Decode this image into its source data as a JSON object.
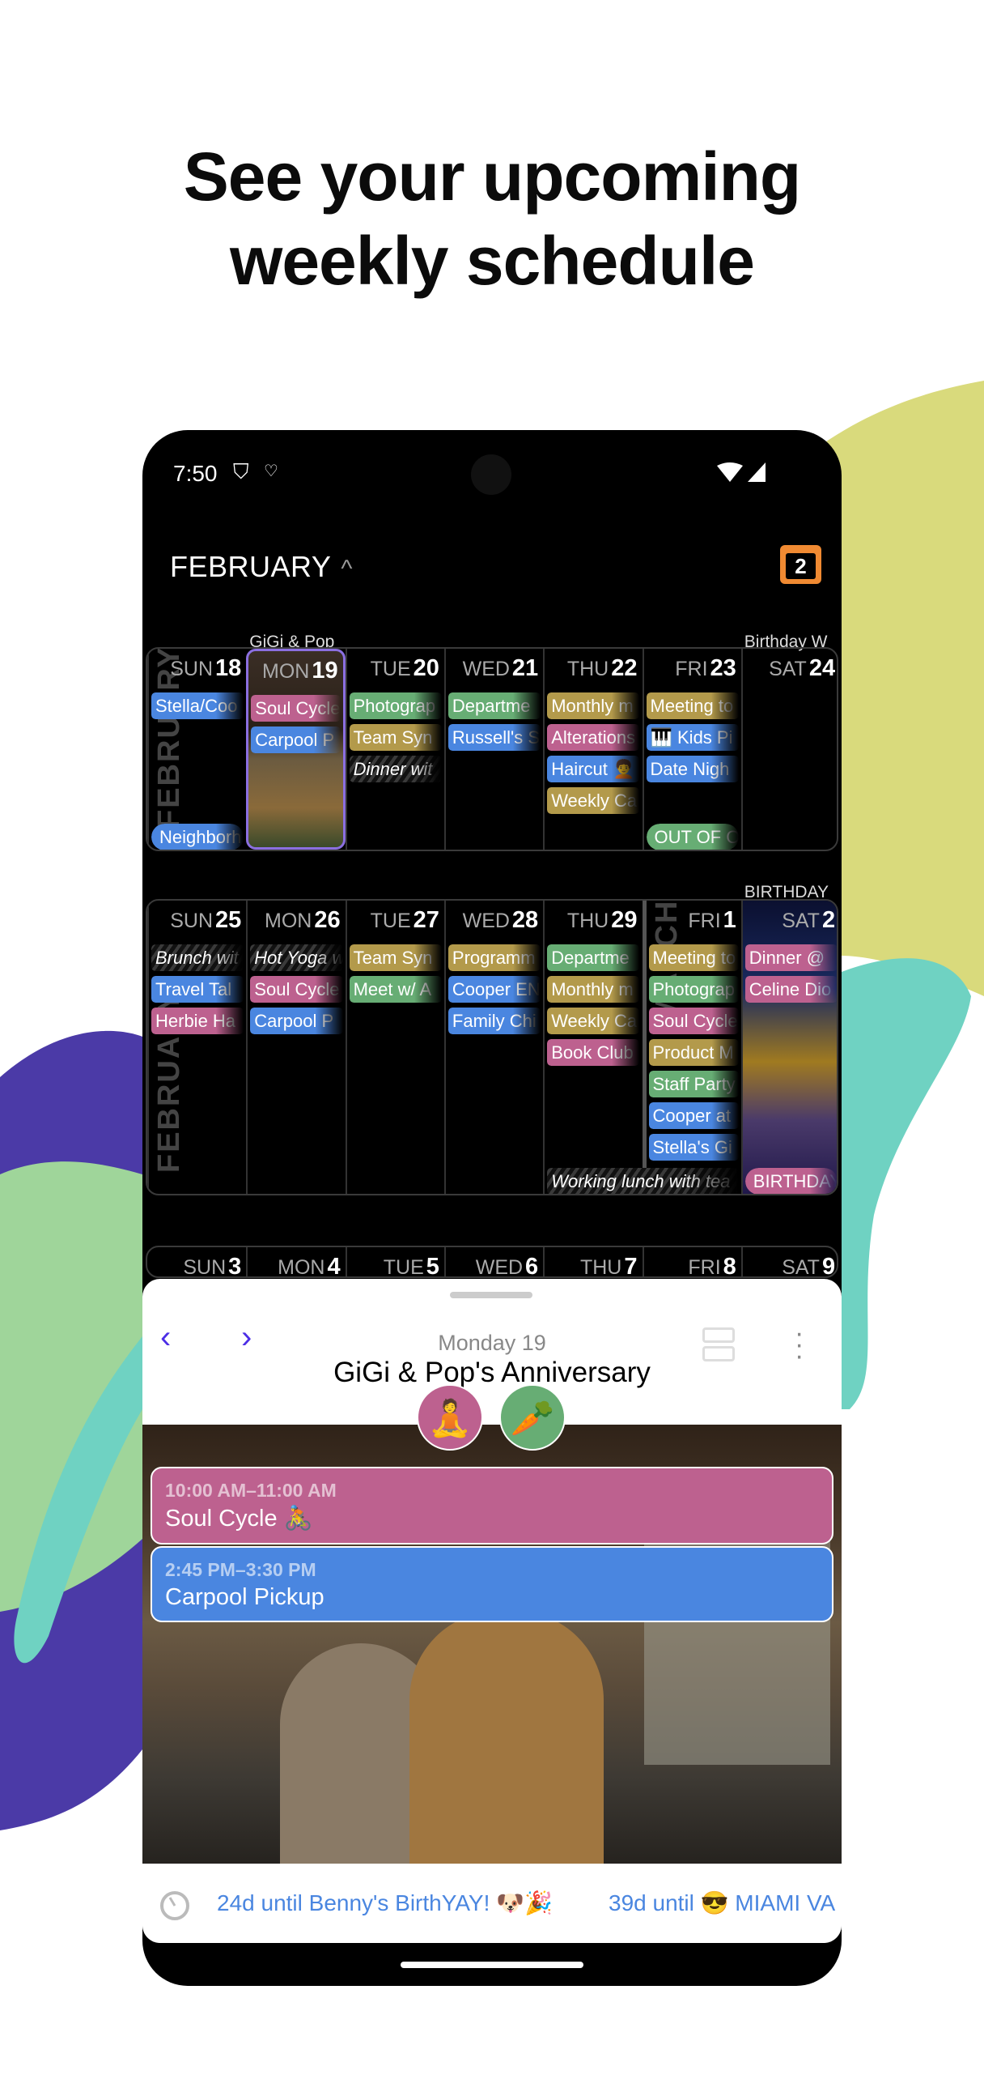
{
  "headline": {
    "line1": "See your upcoming",
    "line2": "weekly schedule"
  },
  "colors": {
    "blue": "#4a86e0",
    "pink": "#bd618f",
    "green": "#67ad74",
    "gold": "#b39a4b",
    "selected_outline": "#8b6fe0",
    "accent": "#4c2ee6",
    "today_badge": "#f08a32"
  },
  "status_bar": {
    "time": "7:50",
    "icons": [
      "shield-icon",
      "accessibility-icon",
      "wifi-icon",
      "signal-icon"
    ]
  },
  "header": {
    "month": "FEBRUARY",
    "chevron": "^",
    "today_badge": "2"
  },
  "weeks": [
    {
      "labels_above": [
        {
          "day": 1,
          "text": "GiGi & Pop"
        },
        {
          "day": 6,
          "text": "Birthday W"
        }
      ],
      "watermark": "FEBRUARY",
      "days": [
        {
          "name": "SUN",
          "date": "18",
          "events": [
            {
              "text": "Stella/Coo",
              "color": "blue"
            }
          ],
          "bottom": {
            "text": "Neighborh",
            "color": "blue"
          }
        },
        {
          "name": "MON",
          "date": "19",
          "selected": true,
          "events": [
            {
              "text": "Soul Cycle",
              "color": "pink"
            },
            {
              "text": "Carpool P",
              "color": "blue"
            }
          ]
        },
        {
          "name": "TUE",
          "date": "20",
          "events": [
            {
              "text": "Photograp",
              "color": "green"
            },
            {
              "text": "Team Syn",
              "color": "gold"
            },
            {
              "text": "Dinner wit",
              "style": "hatch"
            }
          ]
        },
        {
          "name": "WED",
          "date": "21",
          "events": [
            {
              "text": "Departme",
              "color": "green"
            },
            {
              "text": "Russell's S",
              "color": "blue"
            }
          ]
        },
        {
          "name": "THU",
          "date": "22",
          "events": [
            {
              "text": "Monthly m",
              "color": "gold"
            },
            {
              "text": "Alterations",
              "color": "pink"
            },
            {
              "text": "Haircut 🧑‍🦱",
              "color": "blue"
            },
            {
              "text": "Weekly Ca",
              "color": "gold"
            }
          ]
        },
        {
          "name": "FRI",
          "date": "23",
          "events": [
            {
              "text": "Meeting to",
              "color": "gold"
            },
            {
              "text": "🎹 Kids Pi",
              "color": "blue"
            },
            {
              "text": "Date Nigh",
              "color": "blue"
            }
          ],
          "bottom": {
            "text": "OUT OF O",
            "color": "green"
          }
        },
        {
          "name": "SAT",
          "date": "24",
          "events": []
        }
      ]
    },
    {
      "labels_above": [
        {
          "day": 6,
          "text": "BIRTHDAY"
        }
      ],
      "watermark": "FEBRUARY",
      "watermark2": "MARCH",
      "days": [
        {
          "name": "SUN",
          "date": "25",
          "events": [
            {
              "text": "Brunch wit",
              "style": "hatch"
            },
            {
              "text": "Travel Tal",
              "color": "blue"
            },
            {
              "text": "Herbie Ha",
              "color": "pink"
            }
          ]
        },
        {
          "name": "MON",
          "date": "26",
          "events": [
            {
              "text": "Hot Yoga w",
              "style": "hatch"
            },
            {
              "text": "Soul Cycle",
              "color": "pink"
            },
            {
              "text": "Carpool P",
              "color": "blue"
            }
          ]
        },
        {
          "name": "TUE",
          "date": "27",
          "events": [
            {
              "text": "Team Syn",
              "color": "gold"
            },
            {
              "text": "Meet w/ A",
              "color": "green"
            }
          ]
        },
        {
          "name": "WED",
          "date": "28",
          "events": [
            {
              "text": "Programm",
              "color": "gold"
            },
            {
              "text": "Cooper EN",
              "color": "blue"
            },
            {
              "text": "Family Chi",
              "color": "blue"
            }
          ]
        },
        {
          "name": "THU",
          "date": "29",
          "events": [
            {
              "text": "Departme",
              "color": "green"
            },
            {
              "text": "Monthly m",
              "color": "gold"
            },
            {
              "text": "Weekly Ca",
              "color": "gold"
            },
            {
              "text": "Book Club",
              "color": "pink"
            }
          ],
          "bottom": {
            "text": "Working lunch with tea",
            "style": "hatch",
            "span": 2
          }
        },
        {
          "name": "FRI",
          "date": "1",
          "events": [
            {
              "text": "Meeting to",
              "color": "gold"
            },
            {
              "text": "Photograp",
              "color": "green"
            },
            {
              "text": "Soul Cycle",
              "color": "pink"
            },
            {
              "text": "Product M",
              "color": "gold"
            },
            {
              "text": "Staff Party",
              "color": "green"
            },
            {
              "text": "Cooper at",
              "color": "blue"
            },
            {
              "text": "Stella's Gi",
              "color": "blue"
            }
          ]
        },
        {
          "name": "SAT",
          "date": "2",
          "photo": "city-night",
          "events": [
            {
              "text": "Dinner @ ",
              "color": "pink"
            },
            {
              "text": "Celine Dio",
              "color": "pink"
            }
          ],
          "bottom": {
            "text": "BIRTHDAY",
            "color": "pink"
          }
        }
      ]
    },
    {
      "days": [
        {
          "name": "SUN",
          "date": "3"
        },
        {
          "name": "MON",
          "date": "4"
        },
        {
          "name": "TUE",
          "date": "5"
        },
        {
          "name": "WED",
          "date": "6"
        },
        {
          "name": "THU",
          "date": "7"
        },
        {
          "name": "FRI",
          "date": "8"
        },
        {
          "name": "SAT",
          "date": "9"
        }
      ]
    }
  ],
  "detail": {
    "prev": "‹",
    "next": "›",
    "date": "Monday 19",
    "title": "GiGi & Pop's Anniversary",
    "badges": [
      {
        "icon": "yoga-icon",
        "glyph": "🧘",
        "color": "pink"
      },
      {
        "icon": "carrot-icon",
        "glyph": "🥕",
        "color": "green"
      }
    ],
    "events": [
      {
        "time": "10:00 AM–11:00 AM",
        "name": "Soul Cycle 🚴",
        "color": "pink"
      },
      {
        "time": "2:45 PM–3:30 PM",
        "name": "Carpool Pickup",
        "color": "blue"
      }
    ],
    "countdowns": [
      "24d until Benny's BirthYAY! 🐶🎉",
      "39d until 😎 MIAMI VA"
    ]
  }
}
